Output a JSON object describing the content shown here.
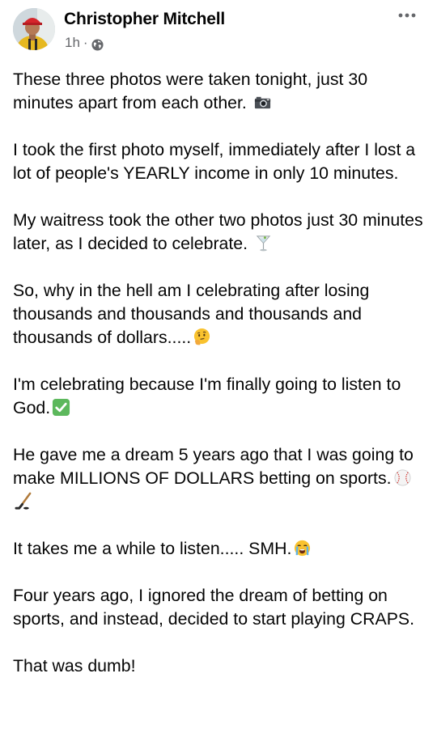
{
  "post": {
    "author": "Christopher Mitchell",
    "time": "1h",
    "separator": "·",
    "privacy_icon": "globe-icon",
    "more_icon": "more-horizontal-icon",
    "paragraphs": [
      "These three photos were taken tonight, just 30 minutes apart from each other.",
      "I took the first photo myself, immediately after I lost a lot of people's YEARLY income in only 10 minutes.",
      "My waitress took the other two photos just 30 minutes later, as I decided to celebrate.",
      "So, why in the hell am I celebrating after losing thousands and thousands and thousands and thousands of dollars.....",
      "I'm celebrating because I'm finally going to listen to God.",
      "He gave me a dream 5 years ago that I was going to make MILLIONS OF DOLLARS betting on sports.",
      "It takes me a while to listen..... SMH.",
      "Four years ago, I ignored the dream of betting on sports, and instead, decided to start playing CRAPS.",
      "That was dumb!"
    ],
    "emojis": {
      "p1": "camera-emoji",
      "p3": "cocktail-glass-emoji",
      "p4": "thinking-face-emoji",
      "p5": "check-mark-button-emoji",
      "p6": [
        "baseball-emoji",
        "hockey-stick-emoji"
      ],
      "p7": "loudly-crying-face-emoji"
    }
  }
}
